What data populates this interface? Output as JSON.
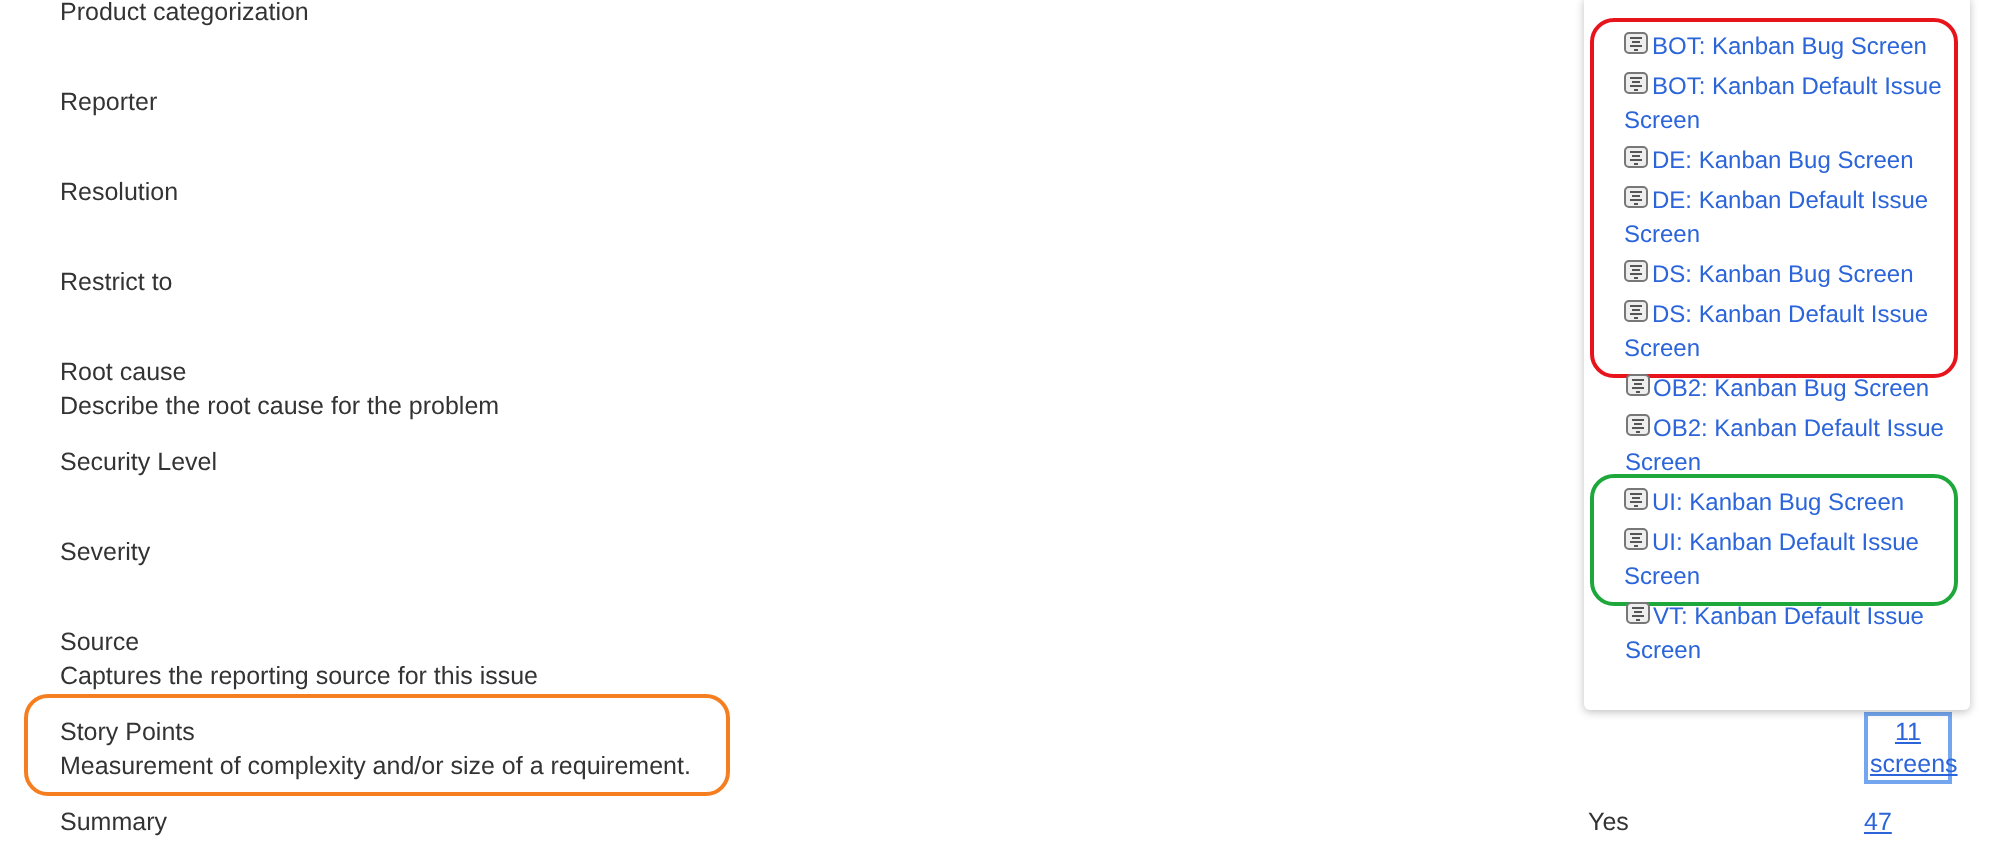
{
  "fields": [
    {
      "label": "Product categorization"
    },
    {
      "label": "Reporter"
    },
    {
      "label": "Resolution"
    },
    {
      "label": "Restrict to"
    },
    {
      "label": "Root cause",
      "description": "Describe the root cause for the problem"
    },
    {
      "label": "Security Level"
    },
    {
      "label": "Severity"
    },
    {
      "label": "Source",
      "description": "Captures the reporting source for this issue"
    },
    {
      "label": "Story Points",
      "description": "Measurement of complexity and/or size of a requirement.",
      "color": "#f57f20",
      "screens_link": "11 screens"
    },
    {
      "label": "Summary",
      "required": "Yes",
      "screens_link": "47"
    }
  ],
  "popup": {
    "groups": [
      {
        "color": "#e8141c",
        "items": [
          "BOT: Kanban Bug Screen",
          "BOT: Kanban Default Issue Screen",
          "DE: Kanban Bug Screen",
          "DE: Kanban Default Issue Screen",
          "DS: Kanban Bug Screen",
          "DS: Kanban Default Issue Screen"
        ]
      },
      {
        "items": [
          "OB2: Kanban Bug Screen",
          "OB2: Kanban Default Issue Screen"
        ]
      },
      {
        "color": "#1ea83c",
        "items": [
          "UI: Kanban Bug Screen",
          "UI: Kanban Default Issue Screen"
        ]
      },
      {
        "items": [
          "VT: Kanban Default Issue Screen"
        ]
      }
    ]
  }
}
